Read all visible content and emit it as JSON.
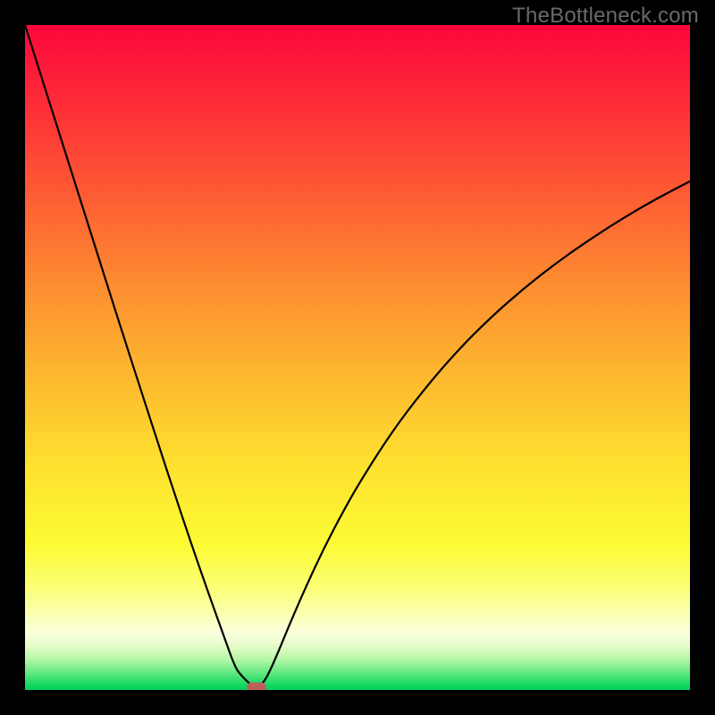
{
  "watermark": "TheBottleneck.com",
  "layout": {
    "image_size": 800,
    "border": 28,
    "plot_size": 744
  },
  "colors": {
    "frame": "#000000",
    "watermark": "#6a6a6a",
    "curve": "#000000",
    "marker": "#bb615b",
    "gradient_stops": [
      {
        "offset": 0.0,
        "color": "#fc063a"
      },
      {
        "offset": 0.12,
        "color": "#fd2d37"
      },
      {
        "offset": 0.25,
        "color": "#fd5a34"
      },
      {
        "offset": 0.38,
        "color": "#fd8931"
      },
      {
        "offset": 0.52,
        "color": "#fdb62f"
      },
      {
        "offset": 0.66,
        "color": "#fee02f"
      },
      {
        "offset": 0.78,
        "color": "#fcfb34"
      },
      {
        "offset": 0.845,
        "color": "#fbff74"
      },
      {
        "offset": 0.885,
        "color": "#faffb0"
      },
      {
        "offset": 0.915,
        "color": "#faffdf"
      },
      {
        "offset": 0.935,
        "color": "#e3fcc6"
      },
      {
        "offset": 0.955,
        "color": "#b2f6a4"
      },
      {
        "offset": 0.975,
        "color": "#5fe87f"
      },
      {
        "offset": 0.992,
        "color": "#14d863"
      },
      {
        "offset": 1.0,
        "color": "#05d05b"
      }
    ]
  },
  "chart_data": {
    "type": "line",
    "title": "",
    "xlabel": "",
    "ylabel": "",
    "xlim": [
      0,
      1
    ],
    "ylim": [
      0,
      1
    ],
    "grid": false,
    "legend": false,
    "x": [
      0.0,
      0.025,
      0.05,
      0.075,
      0.1,
      0.125,
      0.15,
      0.175,
      0.2,
      0.225,
      0.25,
      0.275,
      0.3,
      0.316,
      0.325,
      0.34,
      0.35,
      0.36,
      0.375,
      0.4,
      0.425,
      0.45,
      0.475,
      0.5,
      0.55,
      0.6,
      0.65,
      0.7,
      0.75,
      0.8,
      0.85,
      0.9,
      0.95,
      1.0
    ],
    "values": [
      1.0,
      0.921,
      0.842,
      0.763,
      0.684,
      0.605,
      0.526,
      0.449,
      0.371,
      0.295,
      0.22,
      0.148,
      0.078,
      0.034,
      0.022,
      0.007,
      0.005,
      0.012,
      0.043,
      0.104,
      0.161,
      0.214,
      0.262,
      0.307,
      0.386,
      0.452,
      0.51,
      0.56,
      0.604,
      0.643,
      0.678,
      0.71,
      0.739,
      0.765
    ],
    "min_point": {
      "x": 0.348,
      "y": 0.002
    },
    "marker": {
      "x": 0.348,
      "y": 0.004
    }
  }
}
